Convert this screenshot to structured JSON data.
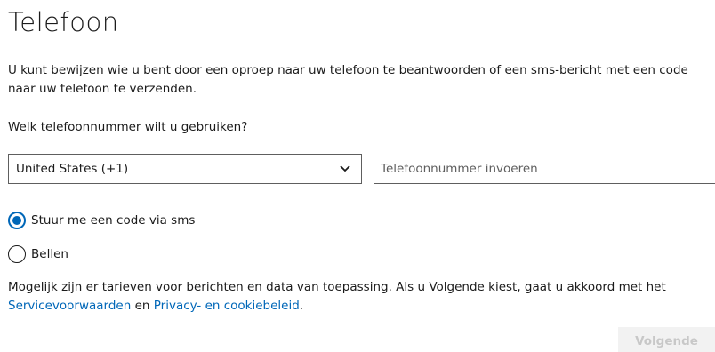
{
  "page": {
    "title": "Telefoon",
    "intro": "U kunt bewijzen wie u bent door een oproep naar uw telefoon te beantwoorden of een sms-bericht met een code naar uw telefoon te verzenden.",
    "question": "Welk telefoonnummer wilt u gebruiken?"
  },
  "form": {
    "country_value": "United States (+1)",
    "phone_placeholder": "Telefoonnummer invoeren",
    "phone_value": "",
    "options": [
      {
        "label": "Stuur me een code via sms",
        "checked": true
      },
      {
        "label": "Bellen",
        "checked": false
      }
    ]
  },
  "disclaimer": {
    "text": "Mogelijk zijn er tarieven voor berichten en data van toepassing. Als u Volgende kiest, gaat u akkoord met het",
    "terms_link": "Servicevoorwaarden",
    "connector": "en",
    "privacy_link": "Privacy- en cookiebeleid",
    "end": "."
  },
  "actions": {
    "next_label": "Volgende"
  },
  "colors": {
    "accent": "#0067b8",
    "text": "#1b1b1b",
    "disabled_bg": "#f2f2f2",
    "disabled_text": "#c8c8c8"
  },
  "icons": {
    "select_chevron": "chevron-down-icon"
  }
}
